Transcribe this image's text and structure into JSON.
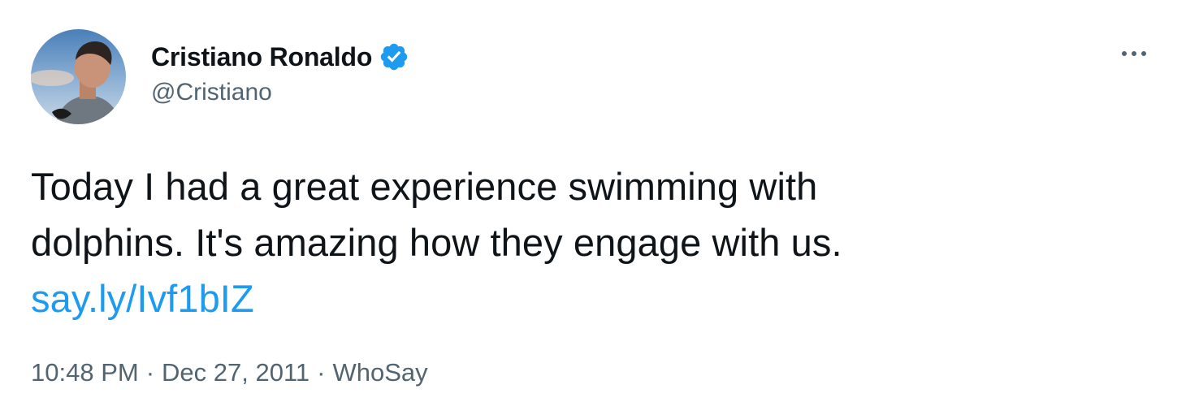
{
  "tweet": {
    "author": {
      "display_name": "Cristiano Ronaldo",
      "handle": "@Cristiano",
      "verified": true,
      "avatar_icon": "profile-photo"
    },
    "more_icon": "more-options-icon",
    "text_line_1": "Today I had a great experience swimming with",
    "text_line_2": "dolphins. It's amazing how they engage with us.",
    "link_text": "say.ly/Ivf1bIZ",
    "time": "10:48 PM",
    "date": "Dec 27, 2011",
    "source": "WhoSay",
    "separator": "·"
  },
  "colors": {
    "text_primary": "#0f1419",
    "text_secondary": "#536471",
    "link": "#1d9bf0",
    "verified_badge": "#1d9bf0"
  }
}
